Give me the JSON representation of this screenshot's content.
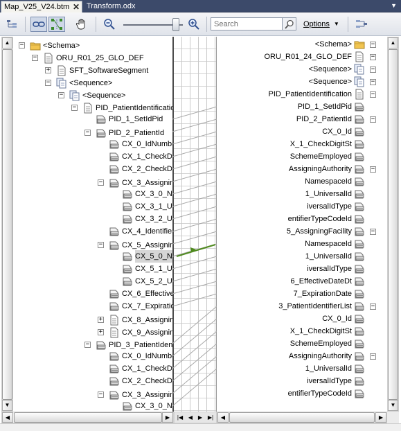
{
  "tabs": [
    {
      "label": "Map_V25_V24.btm",
      "active": true
    },
    {
      "label": "Transform.odx",
      "active": false
    }
  ],
  "toolbar": {
    "search_placeholder": "Search",
    "options_label": "Options"
  },
  "colors": {
    "tabstrip": "#3c4a6a",
    "link_line": "#a8a8a8",
    "selected_link": "#4f8a1e",
    "selection": "#d6d6d6"
  },
  "source_tree": [
    {
      "label": "<Schema>",
      "indent": 0,
      "expander": "-",
      "icon": "folder-icon"
    },
    {
      "label": "ORU_R01_25_GLO_DEF",
      "indent": 1,
      "expander": "-",
      "icon": "document-icon"
    },
    {
      "label": "SFT_SoftwareSegment",
      "indent": 2,
      "expander": "+",
      "icon": "document-icon"
    },
    {
      "label": "<Sequence>",
      "indent": 2,
      "expander": "-",
      "icon": "sequence-icon"
    },
    {
      "label": "<Sequence>",
      "indent": 3,
      "expander": "-",
      "icon": "sequence-icon"
    },
    {
      "label": "PID_PatientIdentificatio",
      "indent": 4,
      "expander": "-",
      "icon": "document-icon"
    },
    {
      "label": "PID_1_SetIdPid",
      "indent": 5,
      "expander": "",
      "icon": "field-icon"
    },
    {
      "label": "PID_2_PatientId",
      "indent": 5,
      "expander": "-",
      "icon": "field-icon"
    },
    {
      "label": "CX_0_IdNumbe",
      "indent": 6,
      "expander": "",
      "icon": "field-icon"
    },
    {
      "label": "CX_1_CheckDi",
      "indent": 6,
      "expander": "",
      "icon": "field-icon"
    },
    {
      "label": "CX_2_CheckDi",
      "indent": 6,
      "expander": "",
      "icon": "field-icon"
    },
    {
      "label": "CX_3_Assignin",
      "indent": 6,
      "expander": "-",
      "icon": "field-icon"
    },
    {
      "label": "CX_3_0_Na",
      "indent": 7,
      "expander": "",
      "icon": "field-icon"
    },
    {
      "label": "CX_3_1_Ur",
      "indent": 7,
      "expander": "",
      "icon": "field-icon"
    },
    {
      "label": "CX_3_2_Ur",
      "indent": 7,
      "expander": "",
      "icon": "field-icon"
    },
    {
      "label": "CX_4_Identifier",
      "indent": 6,
      "expander": "",
      "icon": "field-icon"
    },
    {
      "label": "CX_5_Assignin",
      "indent": 6,
      "expander": "-",
      "icon": "field-icon"
    },
    {
      "label": "CX_5_0_Na",
      "indent": 7,
      "expander": "",
      "icon": "field-icon",
      "selected": true
    },
    {
      "label": "CX_5_1_Ur",
      "indent": 7,
      "expander": "",
      "icon": "field-icon"
    },
    {
      "label": "CX_5_2_Ur",
      "indent": 7,
      "expander": "",
      "icon": "field-icon"
    },
    {
      "label": "CX_6_Effective",
      "indent": 6,
      "expander": "",
      "icon": "field-icon"
    },
    {
      "label": "CX_7_Expiration",
      "indent": 6,
      "expander": "",
      "icon": "field-icon"
    },
    {
      "label": "CX_8_Assignin",
      "indent": 6,
      "expander": "+",
      "icon": "document-icon"
    },
    {
      "label": "CX_9_Assignin",
      "indent": 6,
      "expander": "+",
      "icon": "document-icon"
    },
    {
      "label": "PID_3_PatientIdent",
      "indent": 5,
      "expander": "-",
      "icon": "field-icon"
    },
    {
      "label": "CX_0_IdNumbe",
      "indent": 6,
      "expander": "",
      "icon": "field-icon"
    },
    {
      "label": "CX_1_CheckDi",
      "indent": 6,
      "expander": "",
      "icon": "field-icon"
    },
    {
      "label": "CX_2_CheckDi",
      "indent": 6,
      "expander": "",
      "icon": "field-icon"
    },
    {
      "label": "CX_3_Assignin",
      "indent": 6,
      "expander": "-",
      "icon": "field-icon"
    },
    {
      "label": "CX_3_0_Na",
      "indent": 7,
      "expander": "",
      "icon": "field-icon"
    }
  ],
  "target_tree": [
    {
      "label": "<Schema>",
      "indent": 0,
      "expander": "-",
      "icon": "folder-icon"
    },
    {
      "label": "ORU_R01_24_GLO_DEF",
      "indent": 1,
      "expander": "-",
      "icon": "document-icon"
    },
    {
      "label": "<Sequence>",
      "indent": 2,
      "expander": "-",
      "icon": "sequence-icon"
    },
    {
      "label": "<Sequence>",
      "indent": 3,
      "expander": "-",
      "icon": "sequence-icon"
    },
    {
      "label": "PID_PatientIdentification",
      "indent": 4,
      "expander": "-",
      "icon": "document-icon"
    },
    {
      "label": "PID_1_SetIdPid",
      "indent": 5,
      "expander": "",
      "icon": "field-icon"
    },
    {
      "label": "PID_2_PatientId",
      "indent": 5,
      "expander": "-",
      "icon": "field-icon"
    },
    {
      "label": "CX_0_Id",
      "indent": 6,
      "expander": "",
      "icon": "field-icon"
    },
    {
      "label": "X_1_CheckDigitSt",
      "indent": 6,
      "expander": "",
      "icon": "field-icon"
    },
    {
      "label": "SchemeEmployed",
      "indent": 6,
      "expander": "",
      "icon": "field-icon"
    },
    {
      "label": "AssigningAuthority",
      "indent": 6,
      "expander": "-",
      "icon": "field-icon"
    },
    {
      "label": "NamespaceId",
      "indent": 7,
      "expander": "",
      "icon": "field-icon"
    },
    {
      "label": "1_UniversalId",
      "indent": 7,
      "expander": "",
      "icon": "field-icon"
    },
    {
      "label": "iversalIdType",
      "indent": 7,
      "expander": "",
      "icon": "field-icon"
    },
    {
      "label": "entifierTypeCodeId",
      "indent": 6,
      "expander": "",
      "icon": "field-icon"
    },
    {
      "label": "5_AssigningFacility",
      "indent": 6,
      "expander": "-",
      "icon": "field-icon"
    },
    {
      "label": "NamespaceId",
      "indent": 7,
      "expander": "",
      "icon": "field-icon"
    },
    {
      "label": "1_UniversalId",
      "indent": 7,
      "expander": "",
      "icon": "field-icon"
    },
    {
      "label": "iversalIdType",
      "indent": 7,
      "expander": "",
      "icon": "field-icon"
    },
    {
      "label": "6_EffectiveDateDt",
      "indent": 6,
      "expander": "",
      "icon": "field-icon"
    },
    {
      "label": "7_ExpirationDate",
      "indent": 6,
      "expander": "",
      "icon": "field-icon"
    },
    {
      "label": "3_PatientIdentifierList",
      "indent": 5,
      "expander": "-",
      "icon": "field-icon"
    },
    {
      "label": "CX_0_Id",
      "indent": 6,
      "expander": "",
      "icon": "field-icon"
    },
    {
      "label": "X_1_CheckDigitSt",
      "indent": 6,
      "expander": "",
      "icon": "field-icon"
    },
    {
      "label": "SchemeEmployed",
      "indent": 6,
      "expander": "",
      "icon": "field-icon"
    },
    {
      "label": "AssigningAuthority",
      "indent": 6,
      "expander": "-",
      "icon": "field-icon"
    },
    {
      "label": "1_UniversalId",
      "indent": 7,
      "expander": "",
      "icon": "field-icon"
    },
    {
      "label": "iversalIdType",
      "indent": 7,
      "expander": "",
      "icon": "field-icon"
    },
    {
      "label": "entifierTypeCodeId",
      "indent": 6,
      "expander": "",
      "icon": "field-icon"
    }
  ],
  "links": [
    [
      6,
      5
    ],
    [
      7,
      6
    ],
    [
      8,
      7
    ],
    [
      9,
      8
    ],
    [
      10,
      9
    ],
    [
      11,
      10
    ],
    [
      12,
      11
    ],
    [
      13,
      12
    ],
    [
      14,
      13
    ],
    [
      15,
      14
    ],
    [
      16,
      15
    ],
    [
      17,
      16
    ],
    [
      18,
      17
    ],
    [
      19,
      18
    ],
    [
      20,
      19
    ],
    [
      21,
      20
    ],
    [
      24,
      21
    ],
    [
      25,
      22
    ],
    [
      26,
      23
    ],
    [
      27,
      24
    ],
    [
      28,
      25
    ],
    [
      29,
      26
    ]
  ],
  "selected_link": [
    17,
    16
  ]
}
